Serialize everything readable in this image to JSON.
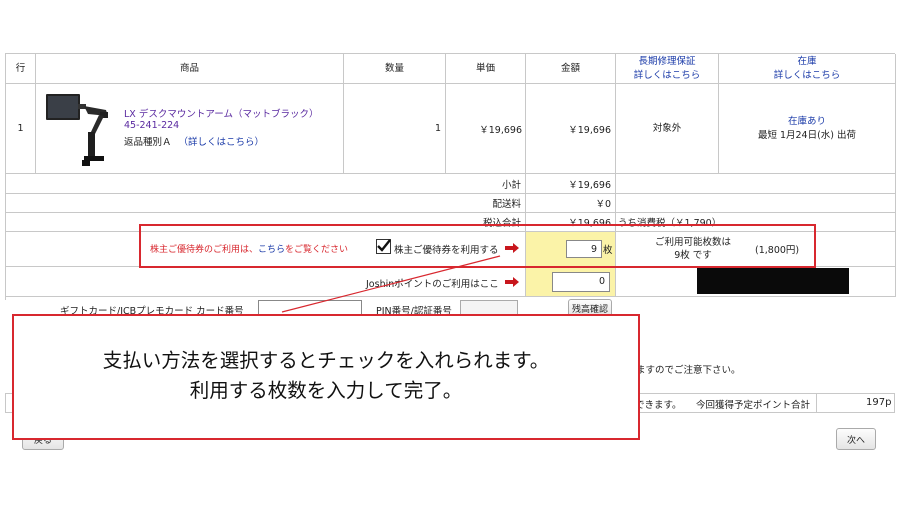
{
  "headers": {
    "row": "行",
    "product": "商品",
    "qty": "数量",
    "unit_price": "単価",
    "amount": "金額",
    "warranty_line1": "長期修理保証",
    "warranty_line2": "詳しくはこちら",
    "stock_line1": "在庫",
    "stock_line2": "詳しくはこちら"
  },
  "item": {
    "row": "1",
    "name": "LX デスクマウントアーム（マットブラック）",
    "code": "45-241-224",
    "return_type": "返品種別Ａ",
    "return_link": "（詳しくはこちら）",
    "qty": "1",
    "unit_price": "￥19,696",
    "amount": "￥19,696",
    "warranty": "対象外",
    "stock_status": "在庫あり",
    "delivery": "最短 1月24日(水) 出荷"
  },
  "totals": {
    "subtotal_label": "小計",
    "subtotal_value": "￥19,696",
    "shipping_label": "配送料",
    "shipping_value": "￥0",
    "total_label": "税込合計",
    "total_value": "￥19,696",
    "tax_note": "うち消費税（￥1,790）"
  },
  "coupon": {
    "notice_prefix": "株主ご優待券のご利用は、",
    "notice_link": "こちら",
    "notice_suffix": "をご覧ください",
    "checkbox_label": "株主ご優待券を利用する",
    "count_value": "9",
    "unit": "枚",
    "available_line1": "ご利用可能枚数は",
    "available_line2": "9枚 です",
    "available_amount": "(1,800円)"
  },
  "points": {
    "label": "Joshinポイントのご利用はここ",
    "value": "0"
  },
  "gift": {
    "card_label": "ギフトカード/JCBプレモカード  カード番号",
    "pin_label": "PIN番号/認証番号",
    "confirm_button": "残高確認"
  },
  "notes": {
    "caution": "ますのでご注意下さい。",
    "points_note": "できます。",
    "points_label": "今回獲得予定ポイント合計",
    "points_value": "197p"
  },
  "buttons": {
    "back": "戻る",
    "next": "次へ"
  },
  "annotation": {
    "line1": "支払い方法を選択するとチェックを入れられます。",
    "line2": "利用する枚数を入力して完了。"
  },
  "colors": {
    "annotation_red": "#d8282f",
    "link_blue": "#1a3aa8",
    "coupon_yellow": "#fbf3a8"
  }
}
